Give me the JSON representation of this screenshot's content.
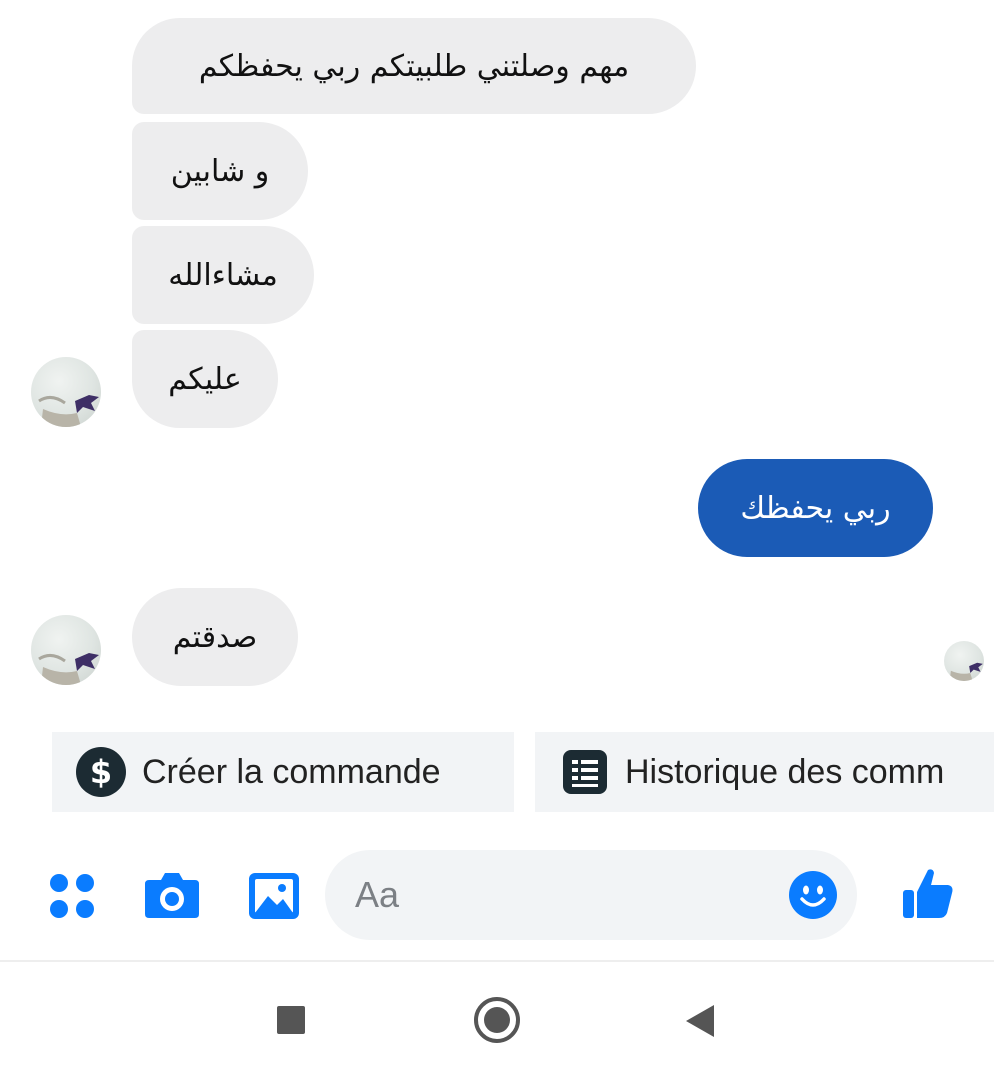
{
  "conversation": {
    "incoming": [
      "مهم وصلتني طلبيتكم ربي يحفظكم",
      "و شابين",
      "مشاءالله",
      "عليكم",
      "صدقتم"
    ],
    "outgoing": [
      "ربي يحفظك"
    ]
  },
  "quick_actions": [
    {
      "label": "Créer la commande",
      "icon": "dollar-circle-icon"
    },
    {
      "label": "Historique des comm",
      "icon": "receipt-icon"
    }
  ],
  "composer": {
    "placeholder": "Aa",
    "icons": [
      "apps-icon",
      "camera-icon",
      "image-icon",
      "emoji-icon",
      "thumbs-up-icon"
    ]
  },
  "navigation": {
    "icons": [
      "recents-square-icon",
      "home-circle-icon",
      "back-triangle-icon"
    ]
  },
  "colors": {
    "accent": "#0a7cff",
    "outgoing_bubble": "#1b5bb6",
    "incoming_bubble": "#ededee",
    "chip_background": "#f2f4f6"
  }
}
